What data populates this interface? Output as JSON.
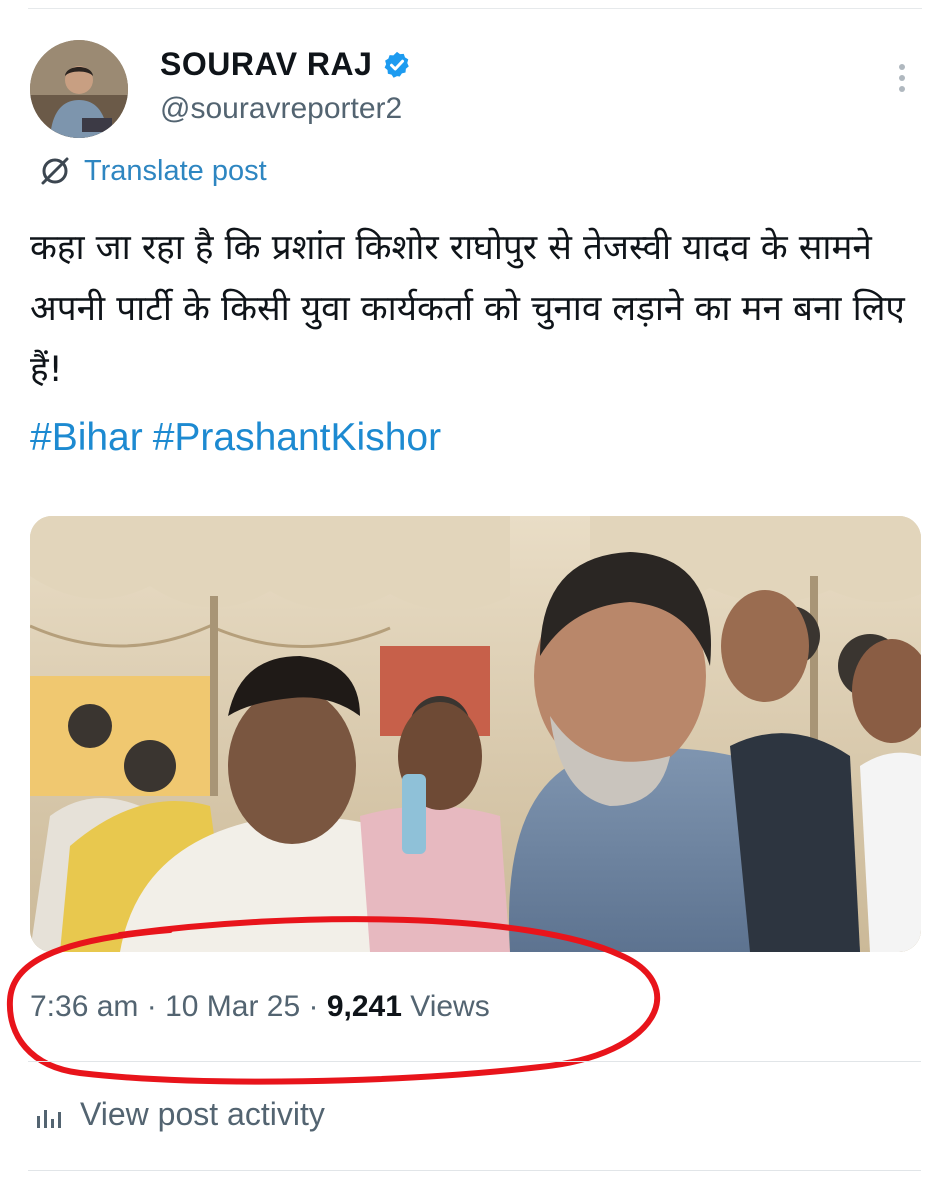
{
  "author": {
    "display_name": "SOURAV RAJ",
    "handle": "@souravreporter2",
    "verified_icon": "verified-badge-icon"
  },
  "actions": {
    "more_icon": "more-vertical-icon",
    "translate_label": "Translate post",
    "translate_icon": "translate-icon"
  },
  "post": {
    "text": "कहा जा रहा है कि प्रशांत किशोर राघोपुर से तेजस्वी यादव के सामने अपनी पार्टी के किसी युवा कार्यकर्ता को चुनाव लड़ाने का मन बना लिए हैं!",
    "hashtags": [
      "#Bihar",
      "#PrashantKishor"
    ],
    "media_type": "photo"
  },
  "meta": {
    "time": "7:36 am",
    "separator": " · ",
    "date": "10 Mar 25",
    "views_count": "9,241",
    "views_label": " Views"
  },
  "activity": {
    "label": "View post activity",
    "icon": "bar-chart-icon"
  },
  "colors": {
    "accent": "#1d9bf0",
    "annotation": "#e8141b"
  }
}
